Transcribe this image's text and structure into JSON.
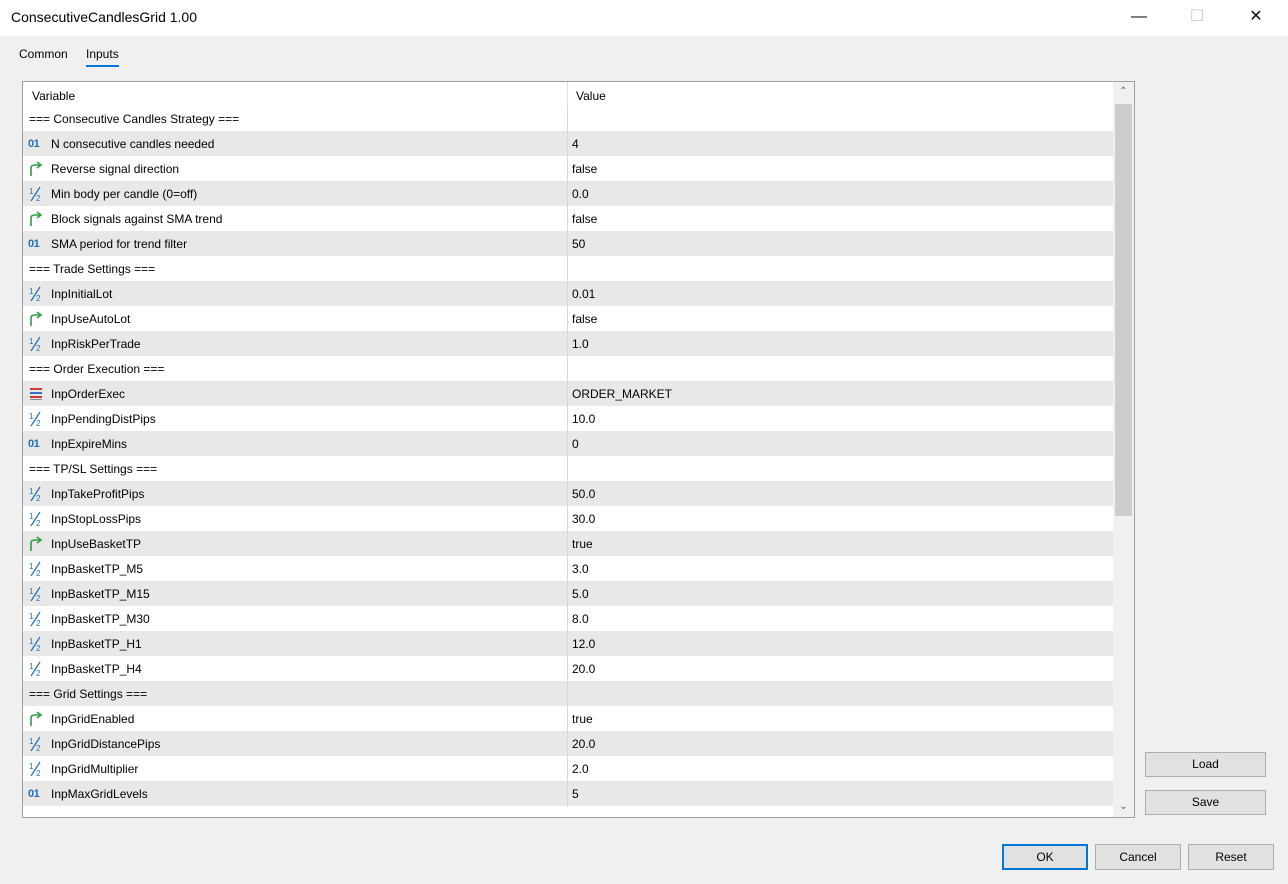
{
  "window": {
    "title": "ConsecutiveCandlesGrid 1.00",
    "minimize": "—",
    "maximize": "☐",
    "close": "✕"
  },
  "tabs": [
    {
      "label": "Common",
      "active": false
    },
    {
      "label": "Inputs",
      "active": true
    }
  ],
  "table": {
    "columns": [
      "Variable",
      "Value"
    ],
    "rows": [
      {
        "type": "section",
        "name": "=== Consecutive Candles Strategy ===",
        "value": ""
      },
      {
        "type": "int",
        "icon": "int-icon",
        "name": "N consecutive candles needed",
        "value": "4"
      },
      {
        "type": "bool",
        "icon": "bool-arrow-icon",
        "name": "Reverse signal direction",
        "value": "false"
      },
      {
        "type": "double",
        "icon": "double-icon",
        "name": "Min body per candle (0=off)",
        "value": "0.0"
      },
      {
        "type": "bool",
        "icon": "bool-arrow-icon",
        "name": "Block signals against SMA trend",
        "value": "false"
      },
      {
        "type": "int",
        "icon": "int-icon",
        "name": "SMA period for trend filter",
        "value": "50"
      },
      {
        "type": "section",
        "name": "=== Trade Settings ===",
        "value": ""
      },
      {
        "type": "double",
        "icon": "double-icon",
        "name": "InpInitialLot",
        "value": "0.01"
      },
      {
        "type": "bool",
        "icon": "bool-arrow-icon",
        "name": "InpUseAutoLot",
        "value": "false"
      },
      {
        "type": "double",
        "icon": "double-icon",
        "name": "InpRiskPerTrade",
        "value": "1.0"
      },
      {
        "type": "section",
        "name": "=== Order Execution ===",
        "value": ""
      },
      {
        "type": "enum",
        "icon": "enum-list-icon",
        "name": "InpOrderExec",
        "value": "ORDER_MARKET"
      },
      {
        "type": "double",
        "icon": "double-icon",
        "name": "InpPendingDistPips",
        "value": "10.0"
      },
      {
        "type": "int",
        "icon": "int-icon",
        "name": "InpExpireMins",
        "value": "0"
      },
      {
        "type": "section",
        "name": "=== TP/SL Settings ===",
        "value": ""
      },
      {
        "type": "double",
        "icon": "double-icon",
        "name": "InpTakeProfitPips",
        "value": "50.0"
      },
      {
        "type": "double",
        "icon": "double-icon",
        "name": "InpStopLossPips",
        "value": "30.0"
      },
      {
        "type": "bool",
        "icon": "bool-arrow-icon",
        "name": "InpUseBasketTP",
        "value": "true"
      },
      {
        "type": "double",
        "icon": "double-icon",
        "name": "InpBasketTP_M5",
        "value": "3.0"
      },
      {
        "type": "double",
        "icon": "double-icon",
        "name": "InpBasketTP_M15",
        "value": "5.0"
      },
      {
        "type": "double",
        "icon": "double-icon",
        "name": "InpBasketTP_M30",
        "value": "8.0"
      },
      {
        "type": "double",
        "icon": "double-icon",
        "name": "InpBasketTP_H1",
        "value": "12.0"
      },
      {
        "type": "double",
        "icon": "double-icon",
        "name": "InpBasketTP_H4",
        "value": "20.0"
      },
      {
        "type": "section",
        "name": "=== Grid Settings ===",
        "value": ""
      },
      {
        "type": "bool",
        "icon": "bool-arrow-icon",
        "name": "InpGridEnabled",
        "value": "true"
      },
      {
        "type": "double",
        "icon": "double-icon",
        "name": "InpGridDistancePips",
        "value": "20.0"
      },
      {
        "type": "double",
        "icon": "double-icon",
        "name": "InpGridMultiplier",
        "value": "2.0"
      },
      {
        "type": "int",
        "icon": "int-icon",
        "name": "InpMaxGridLevels",
        "value": "5"
      }
    ]
  },
  "buttons": {
    "load": "Load",
    "save": "Save",
    "ok": "OK",
    "cancel": "Cancel",
    "reset": "Reset"
  },
  "scrollbar": {
    "up": "⌃",
    "down": "⌄"
  }
}
